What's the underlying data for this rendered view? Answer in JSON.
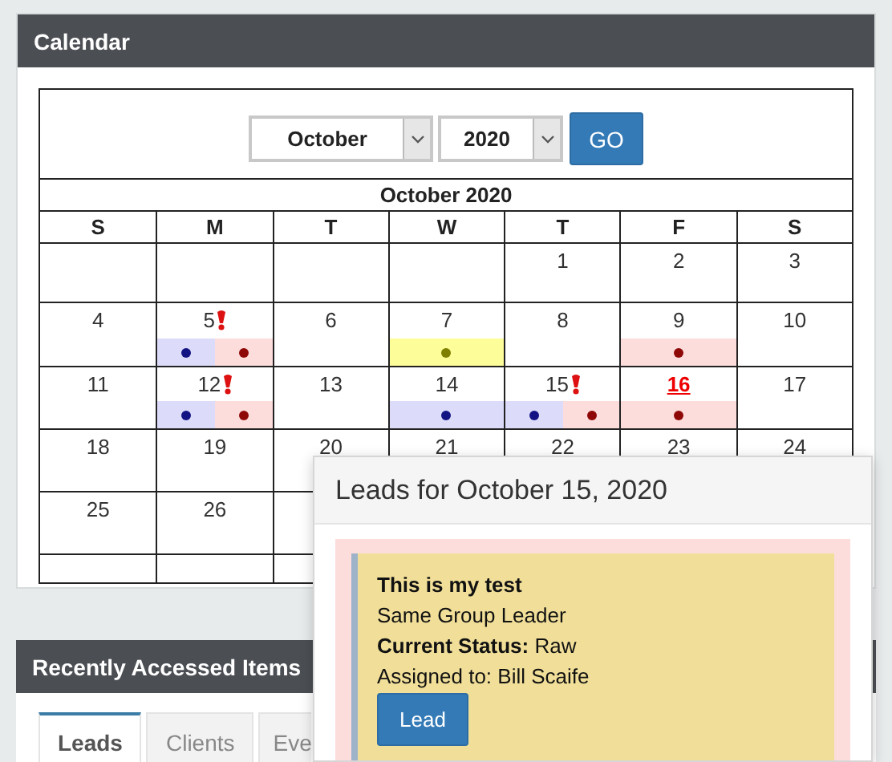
{
  "calendar": {
    "title": "Calendar",
    "month_select": {
      "value": "October"
    },
    "year_select": {
      "value": "2020"
    },
    "go_button": "GO",
    "month_title": "October 2020",
    "weekdays": [
      "S",
      "M",
      "T",
      "W",
      "T",
      "F",
      "S"
    ],
    "weeks": [
      {
        "days": [
          {
            "day": "1"
          },
          {
            "day": "2"
          },
          {
            "day": "3"
          }
        ]
      },
      {
        "days": [
          {
            "day": "4"
          },
          {
            "day": "5",
            "alert": true,
            "events": [
              {
                "color": "#dcdcfa"
              },
              {
                "color": "#fddcdc"
              }
            ]
          },
          {
            "day": "6"
          },
          {
            "day": "7",
            "events": [
              {
                "color": "#fdfd99"
              }
            ]
          },
          {
            "day": "8"
          },
          {
            "day": "9",
            "events": [
              {
                "color": "#fddcdc"
              }
            ]
          },
          {
            "day": "10"
          }
        ]
      },
      {
        "days": [
          {
            "day": "11"
          },
          {
            "day": "12",
            "alert": true,
            "events": [
              {
                "color": "#dcdcfa"
              },
              {
                "color": "#fddcdc"
              }
            ]
          },
          {
            "day": "13"
          },
          {
            "day": "14",
            "events": [
              {
                "color": "#dcdcfa"
              }
            ]
          },
          {
            "day": "15",
            "alert": true,
            "events": [
              {
                "color": "#dcdcfa"
              },
              {
                "color": "#fddcdc"
              }
            ]
          },
          {
            "day": "16",
            "today": true,
            "events": [
              {
                "color": "#fddcdc"
              }
            ]
          },
          {
            "day": "17"
          }
        ]
      },
      {
        "days": [
          {
            "day": "18"
          },
          {
            "day": "19"
          },
          {
            "day": "20"
          },
          {
            "day": "21"
          },
          {
            "day": "22"
          },
          {
            "day": "23"
          },
          {
            "day": "24"
          }
        ]
      },
      {
        "days": [
          {
            "day": "25"
          },
          {
            "day": "26"
          }
        ]
      }
    ]
  },
  "recent": {
    "title": "Recently Accessed Items",
    "tabs": [
      {
        "label": "Leads",
        "selected": true
      },
      {
        "label": "Clients",
        "selected": false
      },
      {
        "label": "Eve",
        "selected": false
      }
    ]
  },
  "popup": {
    "title": "Leads for October 15, 2020",
    "lead": {
      "name": "This is my test",
      "group": "Same Group Leader",
      "status": "**Current Status:** Raw",
      "assigned": "Assigned to: Bill Scaife",
      "button": "Lead"
    }
  }
}
